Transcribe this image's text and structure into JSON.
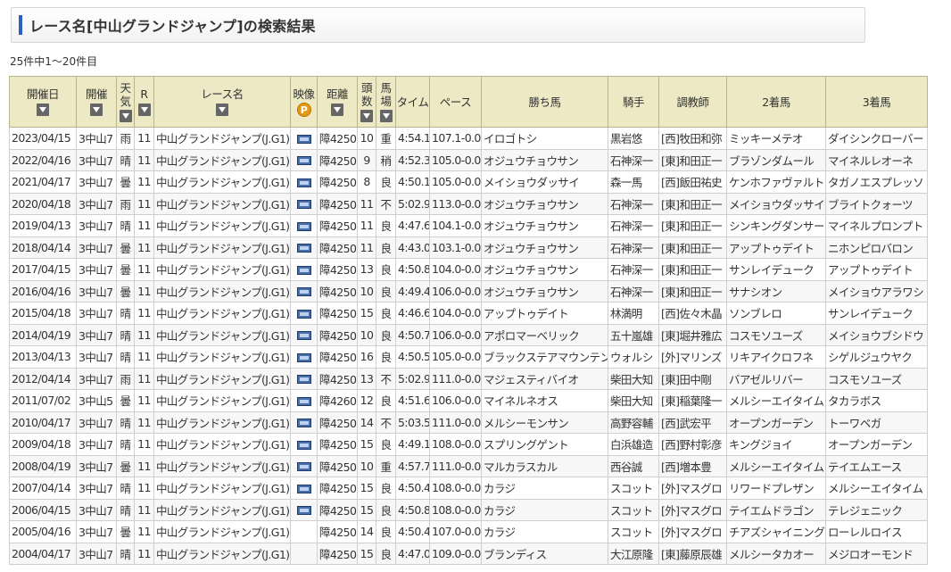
{
  "page": {
    "title": "レース名[中山グランドジャンプ]の検索結果",
    "count_text": "25件中1～20件目"
  },
  "colors": {
    "accent": "#2f5fc0",
    "link": "#1a4ea1",
    "header_bg": "#ece9c4"
  },
  "icons": {
    "sort": "sort-down-icon",
    "video": "video-icon",
    "premium": "premium-p-icon"
  },
  "table": {
    "headers": {
      "date": "開催日",
      "kaisai": "開催",
      "weather_1": "天",
      "weather_2": "気",
      "race_no": "R",
      "race_name": "レース名",
      "video": "映像",
      "premium_label": "P",
      "distance": "距離",
      "horses_1": "頭",
      "horses_2": "数",
      "track_1": "馬",
      "track_2": "場",
      "time": "タイム",
      "pace": "ペース",
      "winner": "勝ち馬",
      "jockey": "騎手",
      "trainer": "調教師",
      "second": "2着馬",
      "third": "3着馬"
    },
    "rows": [
      {
        "date": "2023/04/15",
        "kaisai": "3中山7",
        "weather": "雨",
        "race_no": "11",
        "race_name": "中山グランドジャンプ(J.G1)",
        "video": true,
        "distance": "障4250",
        "horses": "10",
        "track": "重",
        "time": "4:54.1",
        "pace": "107.1-0.0",
        "winner": "イロゴトシ",
        "jockey": "黒岩悠",
        "trainer": "[西]牧田和弥",
        "second": "ミッキーメテオ",
        "third": "ダイシンクローバー"
      },
      {
        "date": "2022/04/16",
        "kaisai": "3中山7",
        "weather": "晴",
        "race_no": "11",
        "race_name": "中山グランドジャンプ(J.G1)",
        "video": true,
        "distance": "障4250",
        "horses": "9",
        "track": "稍",
        "time": "4:52.3",
        "pace": "105.0-0.0",
        "winner": "オジュウチョウサン",
        "jockey": "石神深一",
        "trainer": "[東]和田正一",
        "second": "ブラゾンダムール",
        "third": "マイネルレオーネ"
      },
      {
        "date": "2021/04/17",
        "kaisai": "3中山7",
        "weather": "曇",
        "race_no": "11",
        "race_name": "中山グランドジャンプ(J.G1)",
        "video": true,
        "distance": "障4250",
        "horses": "8",
        "track": "良",
        "time": "4:50.1",
        "pace": "105.0-0.0",
        "winner": "メイショウダッサイ",
        "jockey": "森一馬",
        "trainer": "[西]飯田祐史",
        "second": "ケンホファヴァルト",
        "third": "タガノエスプレッソ"
      },
      {
        "date": "2020/04/18",
        "kaisai": "3中山7",
        "weather": "雨",
        "race_no": "11",
        "race_name": "中山グランドジャンプ(J.G1)",
        "video": true,
        "distance": "障4250",
        "horses": "11",
        "track": "不",
        "time": "5:02.9",
        "pace": "113.0-0.0",
        "winner": "オジュウチョウサン",
        "jockey": "石神深一",
        "trainer": "[東]和田正一",
        "second": "メイショウダッサイ",
        "third": "ブライトクォーツ"
      },
      {
        "date": "2019/04/13",
        "kaisai": "3中山7",
        "weather": "晴",
        "race_no": "11",
        "race_name": "中山グランドジャンプ(J.G1)",
        "video": true,
        "distance": "障4250",
        "horses": "11",
        "track": "良",
        "time": "4:47.6",
        "pace": "104.1-0.0",
        "winner": "オジュウチョウサン",
        "jockey": "石神深一",
        "trainer": "[東]和田正一",
        "second": "シンキングダンサー",
        "third": "マイネルプロンプト"
      },
      {
        "date": "2018/04/14",
        "kaisai": "3中山7",
        "weather": "曇",
        "race_no": "11",
        "race_name": "中山グランドジャンプ(J.G1)",
        "video": true,
        "distance": "障4250",
        "horses": "11",
        "track": "良",
        "time": "4:43.0",
        "pace": "103.1-0.0",
        "winner": "オジュウチョウサン",
        "jockey": "石神深一",
        "trainer": "[東]和田正一",
        "second": "アップトゥデイト",
        "third": "ニホンピロバロン"
      },
      {
        "date": "2017/04/15",
        "kaisai": "3中山7",
        "weather": "曇",
        "race_no": "11",
        "race_name": "中山グランドジャンプ(J.G1)",
        "video": true,
        "distance": "障4250",
        "horses": "13",
        "track": "良",
        "time": "4:50.8",
        "pace": "104.0-0.0",
        "winner": "オジュウチョウサン",
        "jockey": "石神深一",
        "trainer": "[東]和田正一",
        "second": "サンレイデューク",
        "third": "アップトゥデイト"
      },
      {
        "date": "2016/04/16",
        "kaisai": "3中山7",
        "weather": "曇",
        "race_no": "11",
        "race_name": "中山グランドジャンプ(J.G1)",
        "video": true,
        "distance": "障4250",
        "horses": "10",
        "track": "良",
        "time": "4:49.4",
        "pace": "106.0-0.0",
        "winner": "オジュウチョウサン",
        "jockey": "石神深一",
        "trainer": "[東]和田正一",
        "second": "サナシオン",
        "third": "メイショウアラワシ"
      },
      {
        "date": "2015/04/18",
        "kaisai": "3中山7",
        "weather": "晴",
        "race_no": "11",
        "race_name": "中山グランドジャンプ(J.G1)",
        "video": true,
        "distance": "障4250",
        "horses": "15",
        "track": "良",
        "time": "4:46.6",
        "pace": "104.0-0.0",
        "winner": "アップトゥデイト",
        "jockey": "林満明",
        "trainer": "[西]佐々木晶",
        "second": "ソンブレロ",
        "third": "サンレイデューク"
      },
      {
        "date": "2014/04/19",
        "kaisai": "3中山7",
        "weather": "晴",
        "race_no": "11",
        "race_name": "中山グランドジャンプ(J.G1)",
        "video": true,
        "distance": "障4250",
        "horses": "10",
        "track": "良",
        "time": "4:50.7",
        "pace": "106.0-0.0",
        "winner": "アポロマーベリック",
        "jockey": "五十嵐雄",
        "trainer": "[東]堀井雅広",
        "second": "コスモソユーズ",
        "third": "メイショウブシドウ"
      },
      {
        "date": "2013/04/13",
        "kaisai": "3中山7",
        "weather": "晴",
        "race_no": "11",
        "race_name": "中山グランドジャンプ(J.G1)",
        "video": true,
        "distance": "障4250",
        "horses": "16",
        "track": "良",
        "time": "4:50.5",
        "pace": "105.0-0.0",
        "winner": "ブラックステアマウンテン",
        "jockey": "ウォルシ",
        "trainer": "[外]マリンズ",
        "second": "リキアイクロフネ",
        "third": "シゲルジュウヤク"
      },
      {
        "date": "2012/04/14",
        "kaisai": "3中山7",
        "weather": "雨",
        "race_no": "11",
        "race_name": "中山グランドジャンプ(J.G1)",
        "video": true,
        "distance": "障4250",
        "horses": "13",
        "track": "不",
        "time": "5:02.9",
        "pace": "111.0-0.0",
        "winner": "マジェスティバイオ",
        "jockey": "柴田大知",
        "trainer": "[東]田中剛",
        "second": "バアゼルリバー",
        "third": "コスモソユーズ"
      },
      {
        "date": "2011/07/02",
        "kaisai": "3中山5",
        "weather": "曇",
        "race_no": "11",
        "race_name": "中山グランドジャンプ(J.G1)",
        "video": true,
        "distance": "障4260",
        "horses": "12",
        "track": "良",
        "time": "4:51.6",
        "pace": "106.0-0.0",
        "winner": "マイネルネオス",
        "jockey": "柴田大知",
        "trainer": "[東]稲葉隆一",
        "second": "メルシーエイタイム",
        "third": "タカラボス"
      },
      {
        "date": "2010/04/17",
        "kaisai": "3中山7",
        "weather": "晴",
        "race_no": "11",
        "race_name": "中山グランドジャンプ(J.G1)",
        "video": true,
        "distance": "障4250",
        "horses": "14",
        "track": "不",
        "time": "5:03.5",
        "pace": "111.0-0.0",
        "winner": "メルシーモンサン",
        "jockey": "高野容輔",
        "trainer": "[西]武宏平",
        "second": "オープンガーデン",
        "third": "トーワベガ"
      },
      {
        "date": "2009/04/18",
        "kaisai": "3中山7",
        "weather": "晴",
        "race_no": "11",
        "race_name": "中山グランドジャンプ(J.G1)",
        "video": true,
        "distance": "障4250",
        "horses": "15",
        "track": "良",
        "time": "4:49.1",
        "pace": "108.0-0.0",
        "winner": "スプリングゲント",
        "jockey": "白浜雄造",
        "trainer": "[西]野村彰彦",
        "second": "キングジョイ",
        "third": "オープンガーデン"
      },
      {
        "date": "2008/04/19",
        "kaisai": "3中山7",
        "weather": "曇",
        "race_no": "11",
        "race_name": "中山グランドジャンプ(J.G1)",
        "video": true,
        "distance": "障4250",
        "horses": "10",
        "track": "重",
        "time": "4:57.7",
        "pace": "111.0-0.0",
        "winner": "マルカラスカル",
        "jockey": "西谷誠",
        "trainer": "[西]増本豊",
        "second": "メルシーエイタイム",
        "third": "テイエムエース"
      },
      {
        "date": "2007/04/14",
        "kaisai": "3中山7",
        "weather": "晴",
        "race_no": "11",
        "race_name": "中山グランドジャンプ(J.G1)",
        "video": true,
        "distance": "障4250",
        "horses": "15",
        "track": "良",
        "time": "4:50.4",
        "pace": "108.0-0.0",
        "winner": "カラジ",
        "jockey": "スコット",
        "trainer": "[外]マスグロ",
        "second": "リワードプレザン",
        "third": "メルシーエイタイム"
      },
      {
        "date": "2006/04/15",
        "kaisai": "3中山7",
        "weather": "晴",
        "race_no": "11",
        "race_name": "中山グランドジャンプ(J.G1)",
        "video": true,
        "distance": "障4250",
        "horses": "15",
        "track": "良",
        "time": "4:50.8",
        "pace": "108.0-0.0",
        "winner": "カラジ",
        "jockey": "スコット",
        "trainer": "[外]マスグロ",
        "second": "テイエムドラゴン",
        "third": "テレジェニック"
      },
      {
        "date": "2005/04/16",
        "kaisai": "3中山7",
        "weather": "曇",
        "race_no": "11",
        "race_name": "中山グランドジャンプ(J.G1)",
        "video": false,
        "distance": "障4250",
        "horses": "14",
        "track": "良",
        "time": "4:50.4",
        "pace": "107.0-0.0",
        "winner": "カラジ",
        "jockey": "スコット",
        "trainer": "[外]マスグロ",
        "second": "チアズシャイニング",
        "third": "ローレルロイス"
      },
      {
        "date": "2004/04/17",
        "kaisai": "3中山7",
        "weather": "晴",
        "race_no": "11",
        "race_name": "中山グランドジャンプ(J.G1)",
        "video": false,
        "distance": "障4250",
        "horses": "15",
        "track": "良",
        "time": "4:47.0",
        "pace": "109.0-0.0",
        "winner": "ブランディス",
        "jockey": "大江原隆",
        "trainer": "[東]藤原辰雄",
        "second": "メルシータカオー",
        "third": "メジロオーモンド"
      }
    ]
  }
}
